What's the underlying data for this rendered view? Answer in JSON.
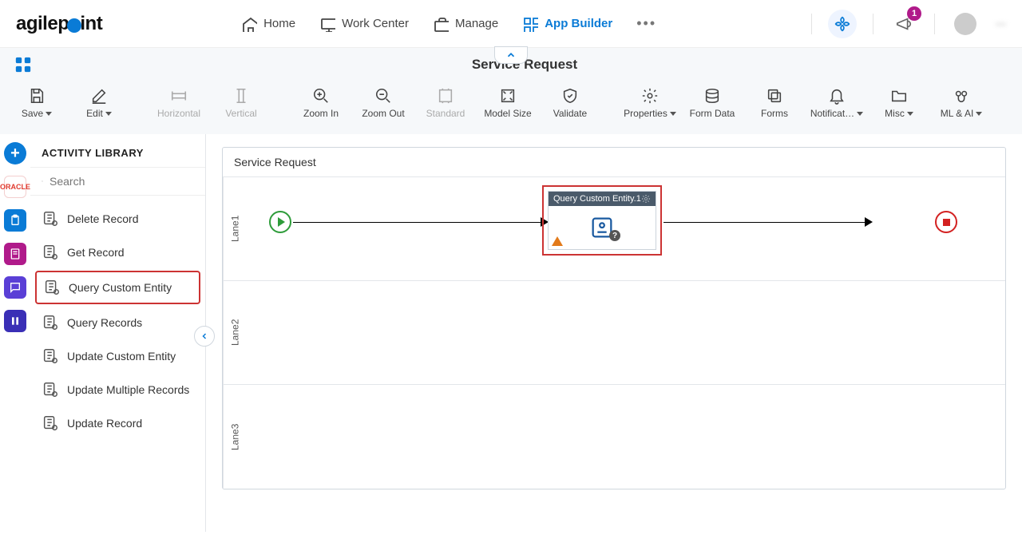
{
  "header": {
    "logo_prefix": "agilep",
    "logo_suffix": "int",
    "nav": [
      {
        "label": "Home",
        "icon": "home"
      },
      {
        "label": "Work Center",
        "icon": "monitor"
      },
      {
        "label": "Manage",
        "icon": "briefcase"
      },
      {
        "label": "App Builder",
        "icon": "grid",
        "active": true
      }
    ],
    "notifications_badge": "1",
    "user_name": "—"
  },
  "page": {
    "title": "Service Request"
  },
  "toolbar": [
    {
      "key": "save",
      "label": "Save",
      "icon": "save",
      "dropdown": true
    },
    {
      "key": "edit",
      "label": "Edit",
      "icon": "edit",
      "dropdown": true
    },
    {
      "key": "horiz",
      "label": "Horizontal",
      "icon": "alignh",
      "disabled": true
    },
    {
      "key": "vert",
      "label": "Vertical",
      "icon": "alignv",
      "disabled": true
    },
    {
      "key": "zin",
      "label": "Zoom In",
      "icon": "zoomin"
    },
    {
      "key": "zout",
      "label": "Zoom Out",
      "icon": "zoomout"
    },
    {
      "key": "std",
      "label": "Standard",
      "icon": "fit",
      "disabled": true
    },
    {
      "key": "msize",
      "label": "Model Size",
      "icon": "expand"
    },
    {
      "key": "val",
      "label": "Validate",
      "icon": "shield"
    },
    {
      "key": "prop",
      "label": "Properties",
      "icon": "gear",
      "dropdown": true
    },
    {
      "key": "fdata",
      "label": "Form Data",
      "icon": "db"
    },
    {
      "key": "forms",
      "label": "Forms",
      "icon": "copy"
    },
    {
      "key": "notif",
      "label": "Notificat…",
      "icon": "bell",
      "dropdown": true
    },
    {
      "key": "misc",
      "label": "Misc",
      "icon": "folder",
      "dropdown": true
    },
    {
      "key": "mlai",
      "label": "ML & AI",
      "icon": "brain",
      "dropdown": true
    }
  ],
  "sidebar": {
    "title": "ACTIVITY LIBRARY",
    "search_placeholder": "Search",
    "items": [
      {
        "label": "Delete Record"
      },
      {
        "label": "Get Record"
      },
      {
        "label": "Query Custom Entity",
        "selected": true
      },
      {
        "label": "Query Records"
      },
      {
        "label": "Update Custom Entity"
      },
      {
        "label": "Update Multiple Records"
      },
      {
        "label": "Update Record"
      }
    ]
  },
  "canvas": {
    "title": "Service Request",
    "lanes": [
      "Lane1",
      "Lane2",
      "Lane3"
    ],
    "activity": {
      "title": "Query Custom Entity.1"
    }
  }
}
